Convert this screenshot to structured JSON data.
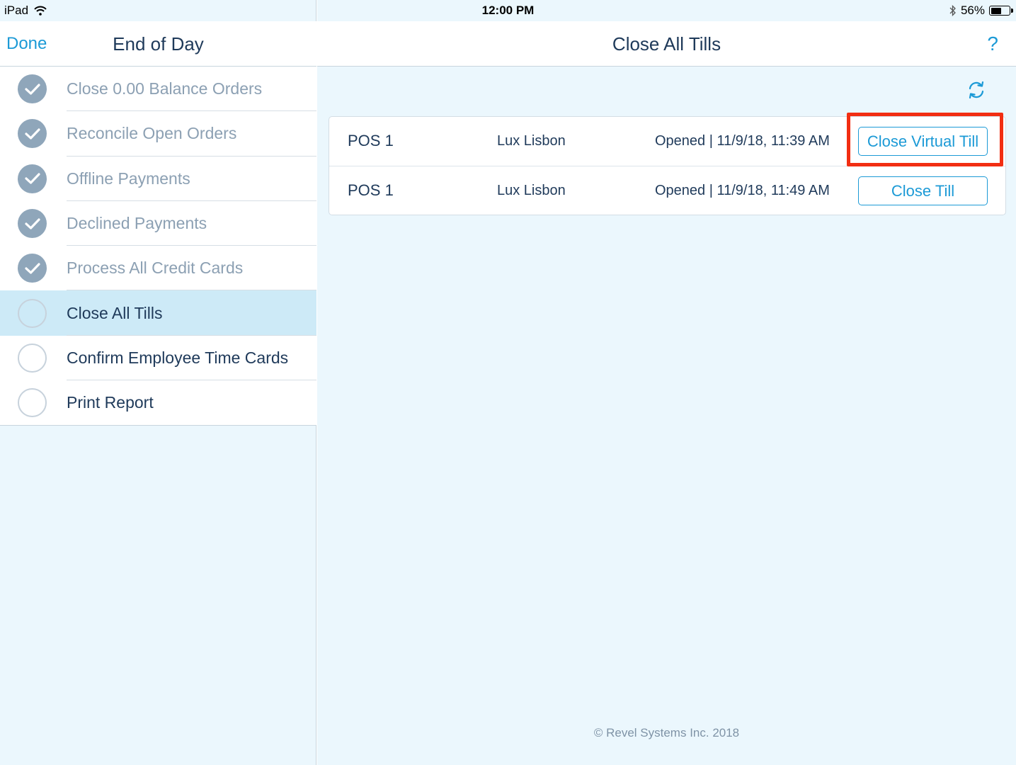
{
  "status_bar": {
    "device": "iPad",
    "time": "12:00 PM",
    "battery_text": "56%",
    "battery_level": 0.56
  },
  "left_pane": {
    "done_label": "Done",
    "title": "End of Day",
    "steps": [
      {
        "label": "Close 0.00 Balance Orders",
        "state": "done"
      },
      {
        "label": "Reconcile Open Orders",
        "state": "done"
      },
      {
        "label": "Offline Payments",
        "state": "done"
      },
      {
        "label": "Declined Payments",
        "state": "done"
      },
      {
        "label": "Process All Credit Cards",
        "state": "done"
      },
      {
        "label": "Close All Tills",
        "state": "active"
      },
      {
        "label": "Confirm Employee Time Cards",
        "state": "todo"
      },
      {
        "label": "Print Report",
        "state": "todo"
      }
    ]
  },
  "right_pane": {
    "title": "Close All Tills",
    "help_label": "?",
    "tills": [
      {
        "name": "POS 1",
        "employee": "Lux Lisbon",
        "status": "Opened | 11/9/18, 11:39 AM",
        "action": "Close Virtual Till"
      },
      {
        "name": "POS 1",
        "employee": "Lux Lisbon",
        "status": "Opened | 11/9/18, 11:49 AM",
        "action": "Close Till"
      }
    ],
    "footer": "© Revel Systems Inc. 2018"
  },
  "colors": {
    "accent": "#1c9ad6",
    "highlight": "#f22e12",
    "active_row": "#cdeaf7",
    "pane_bg": "#ebf7fd"
  }
}
